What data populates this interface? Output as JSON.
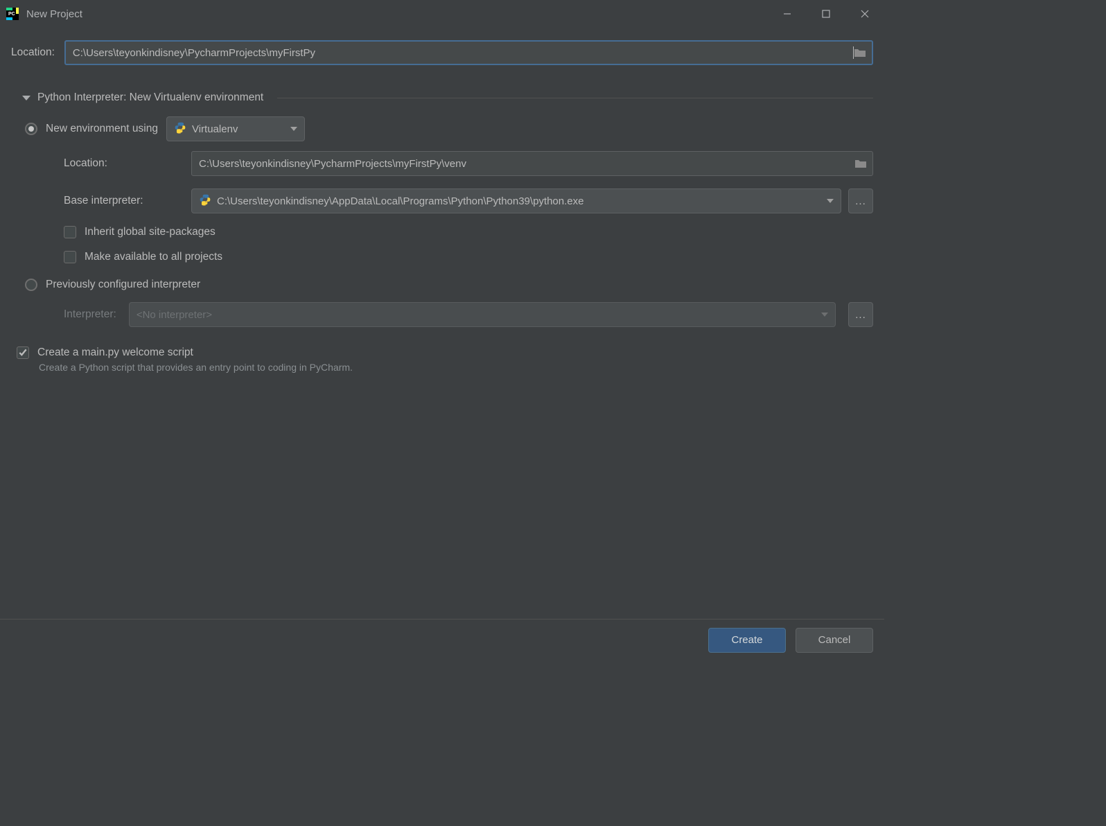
{
  "window": {
    "title": "New Project"
  },
  "location": {
    "label": "Location:",
    "value": "C:\\Users\\teyonkindisney\\PycharmProjects\\myFirstPy"
  },
  "section": {
    "title": "Python Interpreter: New Virtualenv environment"
  },
  "newEnv": {
    "radioLabel": "New environment using",
    "tool": "Virtualenv",
    "locationLabel": "Location:",
    "locationValue": "C:\\Users\\teyonkindisney\\PycharmProjects\\myFirstPy\\venv",
    "baseLabel": "Base interpreter:",
    "baseValue": "C:\\Users\\teyonkindisney\\AppData\\Local\\Programs\\Python\\Python39\\python.exe",
    "inheritLabel": "Inherit global site-packages",
    "makeAvailLabel": "Make available to all projects"
  },
  "prevInterpreter": {
    "radioLabel": "Previously configured interpreter",
    "label": "Interpreter:",
    "value": "<No interpreter>"
  },
  "mainScript": {
    "label": "Create a main.py welcome script",
    "help": "Create a Python script that provides an entry point to coding in PyCharm."
  },
  "buttons": {
    "create": "Create",
    "cancel": "Cancel",
    "ellipsis": "..."
  }
}
